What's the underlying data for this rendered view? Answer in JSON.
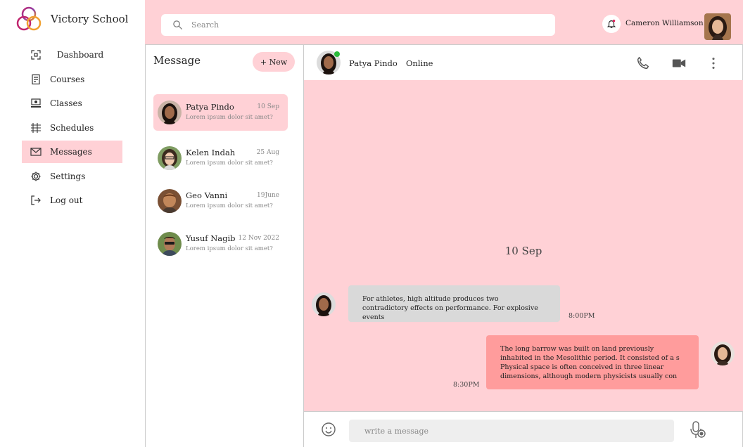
{
  "brand": {
    "name": "Victory School"
  },
  "nav": [
    {
      "label": "Dashboard",
      "icon": "dashboard-icon"
    },
    {
      "label": "Courses",
      "icon": "courses-icon"
    },
    {
      "label": "Classes",
      "icon": "classes-icon"
    },
    {
      "label": "Schedules",
      "icon": "schedules-icon"
    },
    {
      "label": "Messages",
      "icon": "messages-icon",
      "active": true
    },
    {
      "label": "Settings",
      "icon": "settings-icon"
    },
    {
      "label": "Log out",
      "icon": "logout-icon"
    }
  ],
  "header": {
    "search_placeholder": "Search",
    "user_name": "Cameron Williamson"
  },
  "messages_panel": {
    "title": "Message",
    "new_button": "+ New",
    "contacts": [
      {
        "name": "Patya Pindo",
        "date": "10 Sep",
        "preview": "Lorem ipsum dolor sit amet?",
        "active": true
      },
      {
        "name": "Kelen Indah",
        "date": "25 Aug",
        "preview": "Lorem ipsum dolor sit amet?"
      },
      {
        "name": "Geo Vanni",
        "date": "19June",
        "preview": "Lorem ipsum dolor sit amet?"
      },
      {
        "name": "Yusuf Nagib",
        "date": "12 Nov 2022",
        "preview": "Lorem ipsum dolor sit amet?"
      }
    ]
  },
  "chat": {
    "contact_name": "Patya Pindo",
    "status": "Online",
    "date_separator": "10 Sep",
    "incoming": {
      "text": "For athletes, high altitude produces two contradictory effects on performance. For explosive events",
      "time": "8:00PM"
    },
    "outgoing": {
      "text": "The long barrow was built on land previously inhabited in the Mesolithic period. It consisted of a s Physical space is often conceived in three linear dimensions, although modern physicists usually con",
      "time": "8:30PM"
    },
    "composer_placeholder": "write a message"
  },
  "colors": {
    "accent_pink": "#ffd1d6",
    "outgoing_bubble": "#ff9c9c",
    "incoming_bubble": "#d9d9d9",
    "online_dot": "#2bbb3b"
  }
}
